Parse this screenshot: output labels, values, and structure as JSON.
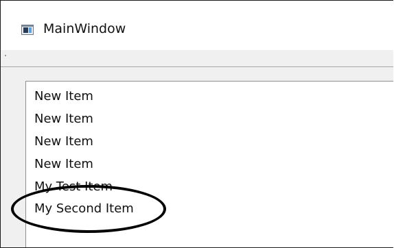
{
  "window": {
    "title": "MainWindow",
    "icon": "app-window-icon"
  },
  "list": {
    "items": [
      {
        "label": "New Item"
      },
      {
        "label": "New Item"
      },
      {
        "label": "New Item"
      },
      {
        "label": "New Item"
      },
      {
        "label": "My Test Item"
      },
      {
        "label": "My Second Item"
      }
    ]
  },
  "annotation": {
    "shape": "hand-drawn-ellipse",
    "color": "#000000",
    "target": "My Second Item"
  }
}
